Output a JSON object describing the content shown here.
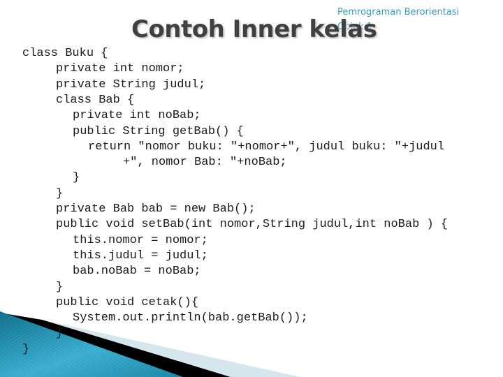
{
  "slide": {
    "subtitle": "Pemrograman Berorientasi\nObjek 1",
    "title": "Contoh Inner kelas",
    "colors": {
      "title": "#404040",
      "subtitle": "#3d9ab2",
      "code": "#1a1a1a",
      "accent_blue": "#1a8fb0",
      "accent_light": "#d6e6ed"
    },
    "code_lines": [
      {
        "indent": 0,
        "text": "class Buku {"
      },
      {
        "indent": 1,
        "text": "private int nomor;"
      },
      {
        "indent": 1,
        "text": "private String judul;"
      },
      {
        "indent": 1,
        "text": "class Bab {"
      },
      {
        "indent": 2,
        "text": "private int noBab;"
      },
      {
        "indent": 2,
        "text": "public String getBab() {"
      },
      {
        "indent": 3,
        "text": "return \"nomor buku: \"+nomor+\", judul buku: \"+judul"
      },
      {
        "indent": 4,
        "text": "+\", nomor Bab: \"+noBab;"
      },
      {
        "indent": 2,
        "text": "}"
      },
      {
        "indent": 1,
        "text": "}"
      },
      {
        "indent": 1,
        "text": "private Bab bab = new Bab();"
      },
      {
        "indent": 1,
        "text": "public void setBab(int nomor,String judul,int noBab ) {"
      },
      {
        "indent": 2,
        "text": "this.nomor = nomor;"
      },
      {
        "indent": 2,
        "text": "this.judul = judul;"
      },
      {
        "indent": 2,
        "text": "bab.noBab = noBab;"
      },
      {
        "indent": 1,
        "text": "}"
      },
      {
        "indent": 1,
        "text": "public void cetak(){"
      },
      {
        "indent": 2,
        "text": "System.out.println(bab.getBab());"
      },
      {
        "indent": 1,
        "text": "}"
      },
      {
        "indent": 0,
        "text": "}"
      }
    ]
  }
}
